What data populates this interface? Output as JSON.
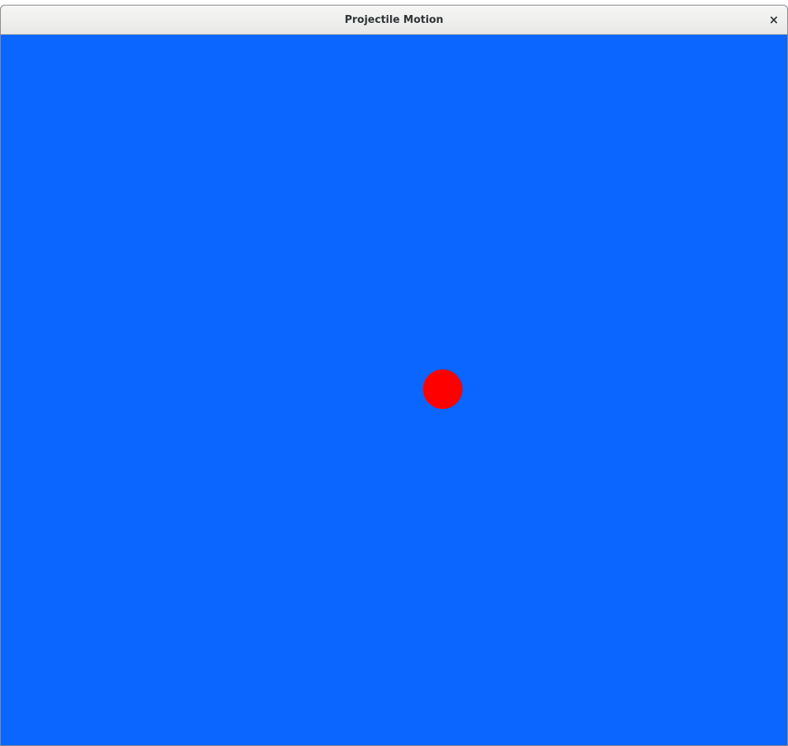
{
  "window": {
    "title": "Projectile Motion",
    "close_glyph": "×",
    "close_icon": "close-icon"
  },
  "colors": {
    "canvas_background": "#0a66ff",
    "projectile": "#ff0000",
    "titlebar": "#ececeb"
  },
  "scene": {
    "projectile_shape": "circle"
  }
}
